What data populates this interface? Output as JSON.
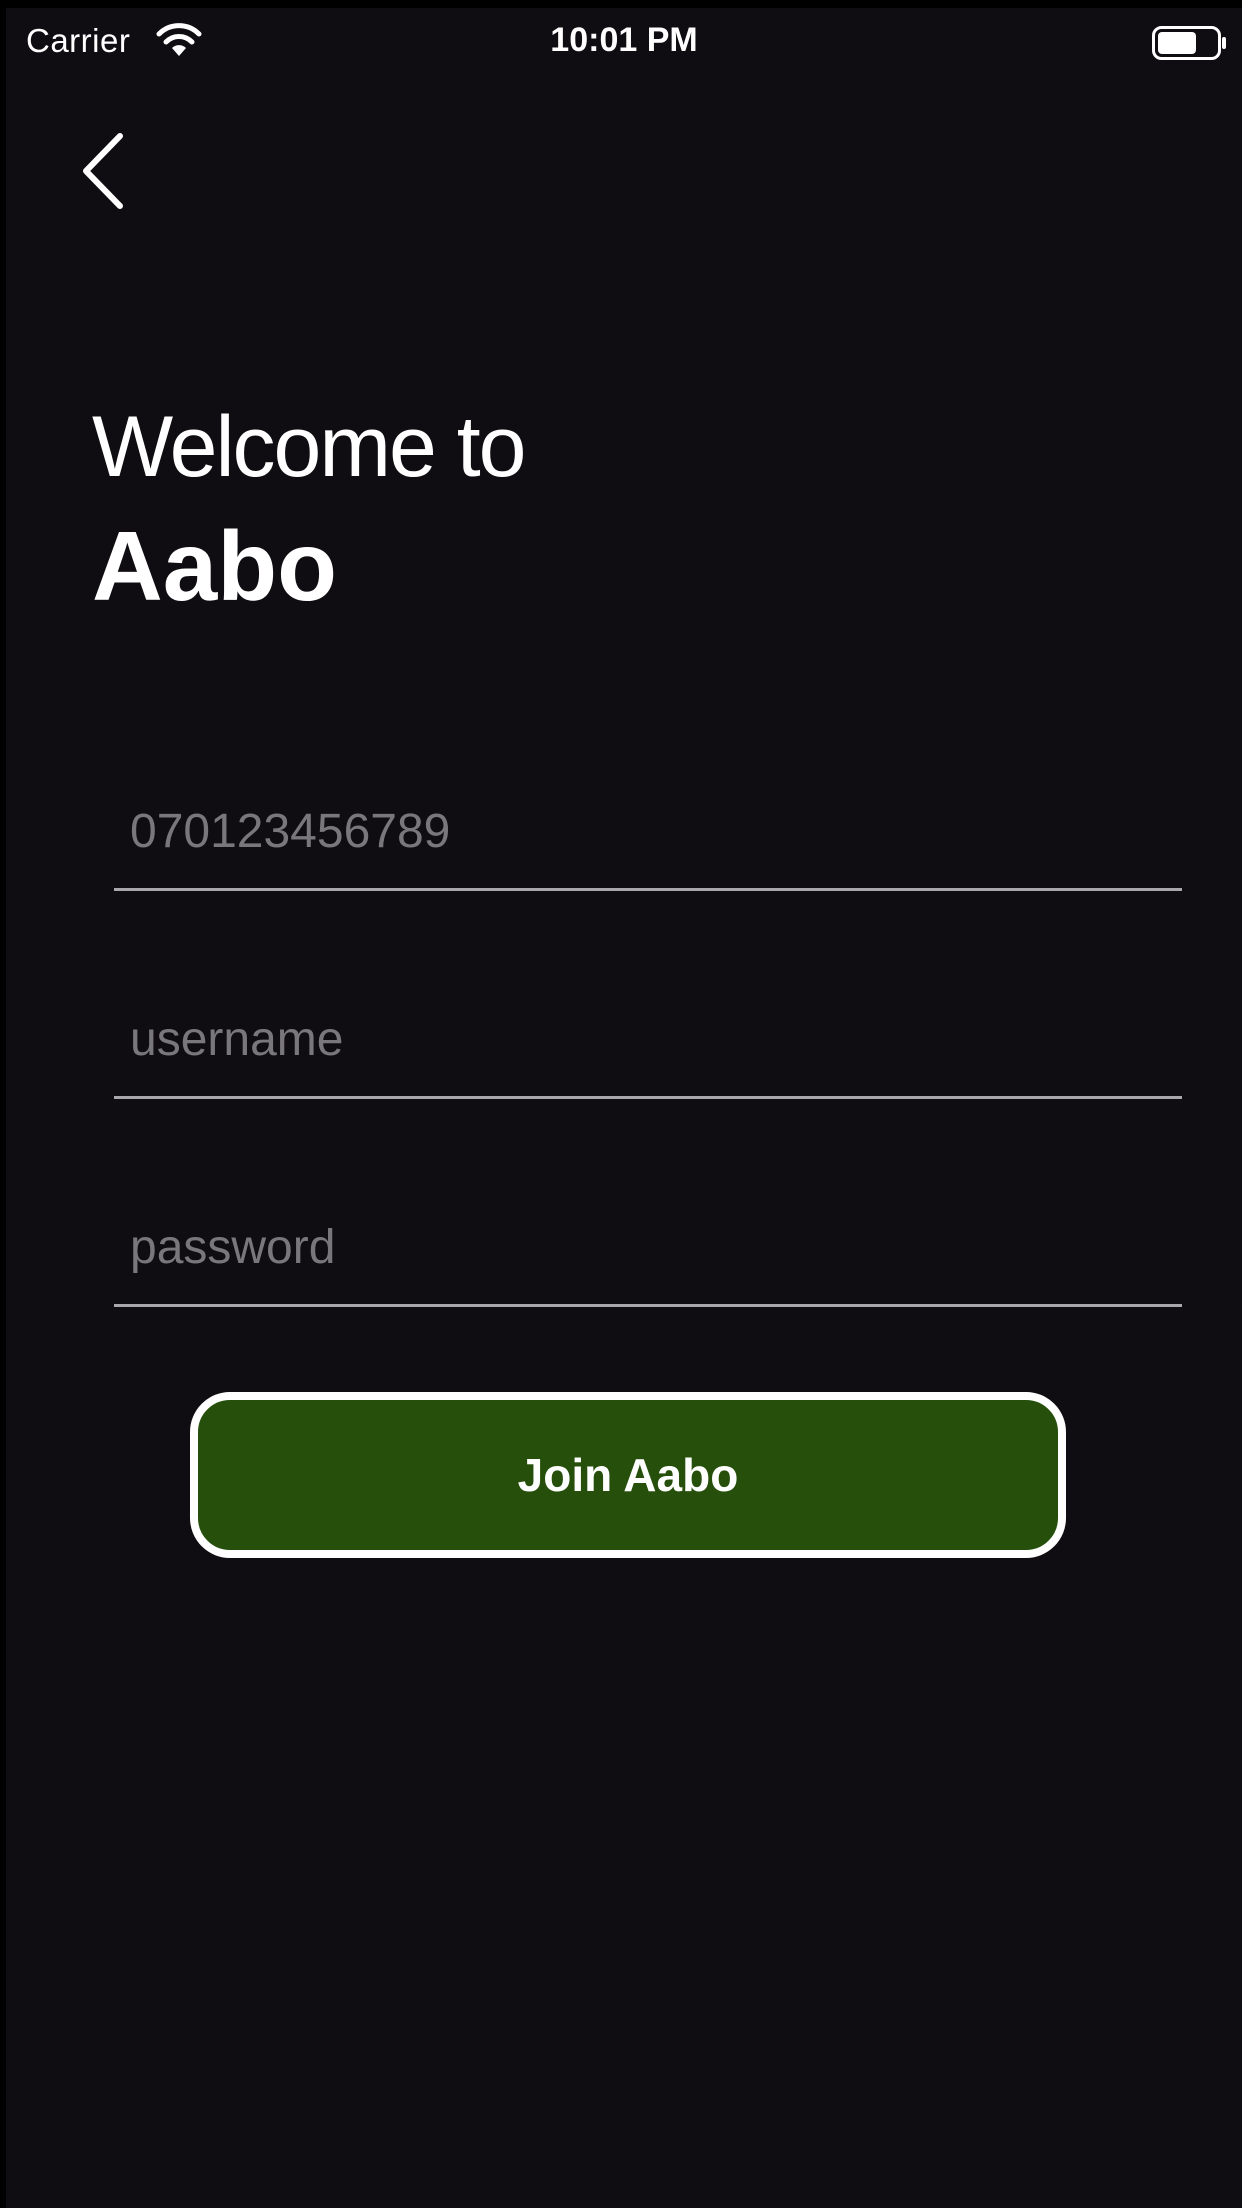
{
  "status_bar": {
    "carrier": "Carrier",
    "time": "10:01 PM",
    "wifi_icon": "wifi-icon",
    "battery_icon": "battery-icon"
  },
  "navigation": {
    "back_icon": "chevron-left-icon"
  },
  "header": {
    "greeting": "Welcome to",
    "app_name": "Aabo"
  },
  "form": {
    "phone_placeholder": "070123456789",
    "username_placeholder": "username",
    "password_placeholder": "password",
    "phone_value": "",
    "username_value": "",
    "password_value": ""
  },
  "actions": {
    "join_label": "Join Aabo"
  },
  "colors": {
    "background": "#100d12",
    "accent": "#254f0a",
    "text": "#ffffff",
    "placeholder": "#79777b",
    "divider": "#a9a7aa"
  }
}
